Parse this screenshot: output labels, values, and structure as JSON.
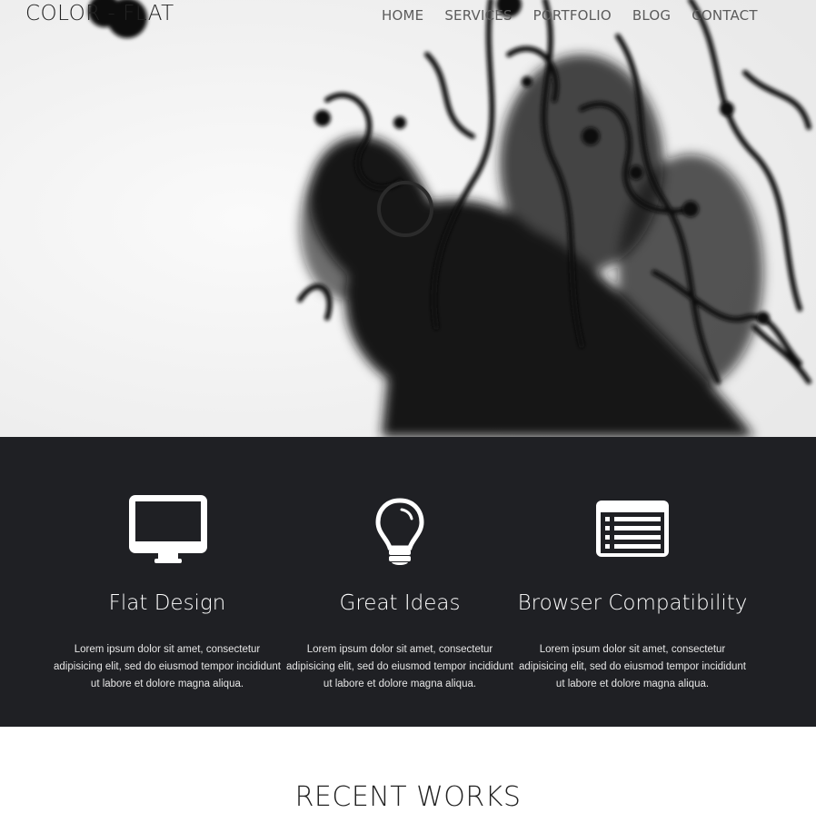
{
  "brand": {
    "logo_text": "COLOR - FLAT"
  },
  "nav": {
    "items": [
      {
        "label": "HOME"
      },
      {
        "label": "SERVICES"
      },
      {
        "label": "PORTFOLIO"
      },
      {
        "label": "BLOG"
      },
      {
        "label": "CONTACT"
      }
    ]
  },
  "hero": {
    "loading_indicator": "spinner-icon"
  },
  "features": [
    {
      "icon": "monitor-icon",
      "title": "Flat Design",
      "text": "Lorem ipsum dolor sit amet, consectetur adipisicing elit, sed do eiusmod tempor incididunt ut labore et dolore magna aliqua."
    },
    {
      "icon": "lightbulb-icon",
      "title": "Great Ideas",
      "text": "Lorem ipsum dolor sit amet, consectetur adipisicing elit, sed do eiusmod tempor incididunt ut labore et dolore magna aliqua."
    },
    {
      "icon": "list-icon",
      "title": "Browser Compatibility",
      "text": "Lorem ipsum dolor sit amet, consectetur adipisicing elit, sed do eiusmod tempor incididunt ut labore et dolore magna aliqua."
    }
  ],
  "recent": {
    "heading": "RECENT WORKS"
  },
  "colors": {
    "dark_band": "#1f2024",
    "nav_text": "#5c5c5c",
    "ink": "#111111"
  }
}
